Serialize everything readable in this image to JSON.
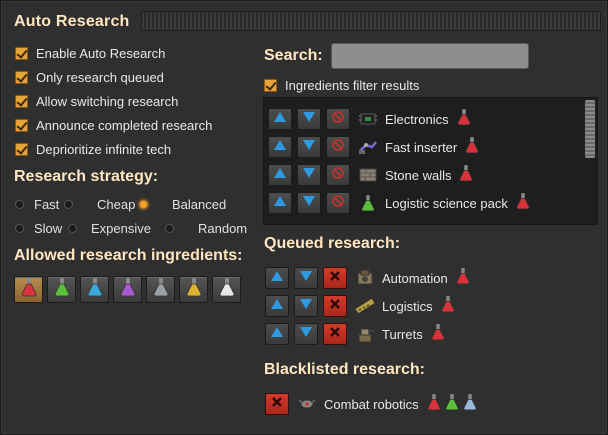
{
  "window": {
    "title": "Auto Research"
  },
  "options": [
    {
      "label": "Enable Auto Research",
      "checked": true
    },
    {
      "label": "Only research queued",
      "checked": true
    },
    {
      "label": "Allow switching research",
      "checked": true
    },
    {
      "label": "Announce completed research",
      "checked": true
    },
    {
      "label": "Deprioritize infinite tech",
      "checked": true
    }
  ],
  "strategy": {
    "heading": "Research strategy:",
    "options": [
      "Fast",
      "Cheap",
      "Balanced",
      "Slow",
      "Expensive",
      "Random"
    ],
    "selected": "Balanced"
  },
  "ingredients": {
    "heading": "Allowed research ingredients:",
    "packs": [
      {
        "icon": "red-flask-icon",
        "color": "#d8323a",
        "selected": true
      },
      {
        "icon": "green-flask-icon",
        "color": "#5bbf3a",
        "selected": false
      },
      {
        "icon": "blue-flask-icon",
        "color": "#3aa8d8",
        "selected": false
      },
      {
        "icon": "purple-flask-icon",
        "color": "#a85ad0",
        "selected": false
      },
      {
        "icon": "gray-flask-icon",
        "color": "#9aa0a8",
        "selected": false
      },
      {
        "icon": "yellow-flask-icon",
        "color": "#e0b030",
        "selected": false
      },
      {
        "icon": "white-flask-icon",
        "color": "#e8e8e8",
        "selected": false
      }
    ]
  },
  "search": {
    "label": "Search:",
    "value": "",
    "filter_label": "Ingredients filter results",
    "filter_checked": true
  },
  "search_results": [
    {
      "name": "Electronics",
      "icon": "circuit-icon",
      "flasks": [
        "#d8323a"
      ]
    },
    {
      "name": "Fast inserter",
      "icon": "inserter-icon",
      "flasks": [
        "#d8323a"
      ]
    },
    {
      "name": "Stone walls",
      "icon": "wall-icon",
      "flasks": [
        "#d8323a"
      ]
    },
    {
      "name": "Logistic science pack",
      "icon": "green-flask-icon",
      "flasks": [
        "#d8323a"
      ]
    }
  ],
  "queued": {
    "heading": "Queued research:",
    "items": [
      {
        "name": "Automation",
        "icon": "assembler-icon",
        "flasks": [
          "#d8323a"
        ]
      },
      {
        "name": "Logistics",
        "icon": "belt-icon",
        "flasks": [
          "#d8323a"
        ]
      },
      {
        "name": "Turrets",
        "icon": "turret-icon",
        "flasks": [
          "#d8323a"
        ]
      }
    ]
  },
  "blacklisted": {
    "heading": "Blacklisted research:",
    "items": [
      {
        "name": "Combat robotics",
        "icon": "robot-icon",
        "flasks": [
          "#d8323a",
          "#5bbf3a",
          "#9ab8d8"
        ]
      }
    ]
  },
  "colors": {
    "accent": "#e9a33c",
    "heading": "#ffe6c0",
    "delete_red": "#c8322a",
    "arrow_blue": "#2f9ae0"
  }
}
